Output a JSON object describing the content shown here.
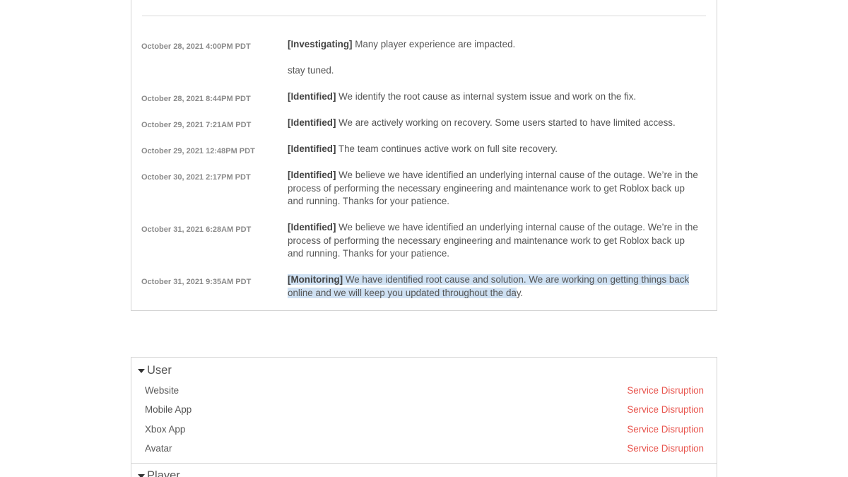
{
  "incident": {
    "updates": [
      {
        "time": "October 28, 2021 4:00PM PDT",
        "status": "[Investigating]",
        "text": " Many player experience are impacted.",
        "extra": "stay tuned."
      },
      {
        "time": "October 28, 2021 8:44PM PDT",
        "status": "[Identified]",
        "text": " We identify the root cause as internal system issue and work on the fix."
      },
      {
        "time": "October 29, 2021 7:21AM PDT",
        "status": "[Identified]",
        "text": " We are actively working on recovery. Some users started to have limited access."
      },
      {
        "time": "October 29, 2021 12:48PM PDT",
        "status": "[Identified]",
        "text": " The team continues active work on full site recovery."
      },
      {
        "time": "October 30, 2021 2:17PM PDT",
        "status": "[Identified]",
        "text": " We believe we have identified an underlying internal cause of the outage.  We’re in the process of performing the necessary engineering and maintenance work to get Roblox back up and running.  Thanks for your patience."
      },
      {
        "time": "October 31, 2021 6:28AM PDT",
        "status": "[Identified]",
        "text": " We believe we have identified an underlying internal cause of the outage.  We’re in the process of performing the necessary engineering and maintenance work to get Roblox back up and running.  Thanks for your patience."
      },
      {
        "time": "October 31, 2021 9:35AM PDT",
        "status": "[Monitoring]",
        "text_highlighted": " We have identified root cause and solution. We are working on getting things back online and we will keep you updated throughout the da",
        "text_rest": "y."
      }
    ]
  },
  "components": {
    "groups": [
      {
        "label": "User",
        "items": [
          {
            "name": "Website",
            "status": "Service Disruption"
          },
          {
            "name": "Mobile App",
            "status": "Service Disruption"
          },
          {
            "name": "Xbox App",
            "status": "Service Disruption"
          },
          {
            "name": "Avatar",
            "status": "Service Disruption"
          }
        ]
      },
      {
        "label": "Player",
        "items": []
      }
    ]
  },
  "colors": {
    "disruption": "#e8554e",
    "highlight": "#cfe1f3"
  }
}
